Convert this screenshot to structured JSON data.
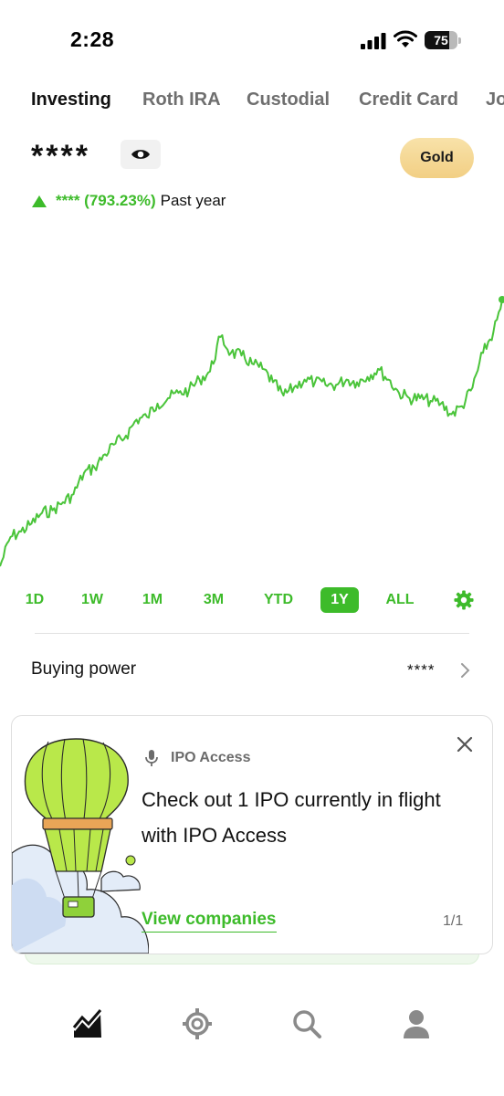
{
  "status_bar": {
    "time": "2:28",
    "battery": "75",
    "battery_level": 0.75
  },
  "account_tabs": [
    {
      "label": "Investing",
      "active": true
    },
    {
      "label": "Roth IRA",
      "active": false
    },
    {
      "label": "Custodial",
      "active": false
    },
    {
      "label": "Credit Card",
      "active": false
    },
    {
      "label": "Jo",
      "active": false
    }
  ],
  "portfolio": {
    "balance": "****",
    "gold_label": "Gold",
    "change_value": "**** (793.23%)",
    "change_period": "Past year",
    "change_direction": "up"
  },
  "range_selector": {
    "options": [
      "1D",
      "1W",
      "1M",
      "3M",
      "YTD",
      "1Y",
      "ALL"
    ],
    "selected": "1Y"
  },
  "buying_power": {
    "label": "Buying power",
    "value": "****"
  },
  "ipo_card": {
    "eyebrow": "IPO Access",
    "headline": "Check out 1 IPO currently in flight with IPO Access",
    "cta": "View companies",
    "pager": "1/1"
  },
  "bottom_nav": [
    {
      "icon": "investing-chart-icon",
      "active": true
    },
    {
      "icon": "crypto-coin-icon",
      "active": false
    },
    {
      "icon": "search-icon",
      "active": false
    },
    {
      "icon": "account-person-icon",
      "active": false
    }
  ],
  "colors": {
    "accent": "#3dbb2a",
    "gold": "#f4d58c",
    "text": "#111111",
    "muted": "#6f6f6f"
  },
  "chart_data": {
    "type": "line",
    "period": "1Y",
    "y_axis_visible": false,
    "grid": false,
    "series": [
      {
        "values": [
          0.0,
          0.11,
          0.13,
          0.16,
          0.2,
          0.21,
          0.24,
          0.27,
          0.35,
          0.37,
          0.42,
          0.46,
          0.49,
          0.55,
          0.56,
          0.61,
          0.63,
          0.65,
          0.66,
          0.7,
          0.73,
          0.86,
          0.8,
          0.79,
          0.76,
          0.74,
          0.69,
          0.64,
          0.67,
          0.7,
          0.69,
          0.68,
          0.68,
          0.7,
          0.69,
          0.71,
          0.74,
          0.7,
          0.65,
          0.63,
          0.63,
          0.62,
          0.61,
          0.57,
          0.6,
          0.67,
          0.8,
          0.88,
          1.0
        ]
      }
    ]
  }
}
